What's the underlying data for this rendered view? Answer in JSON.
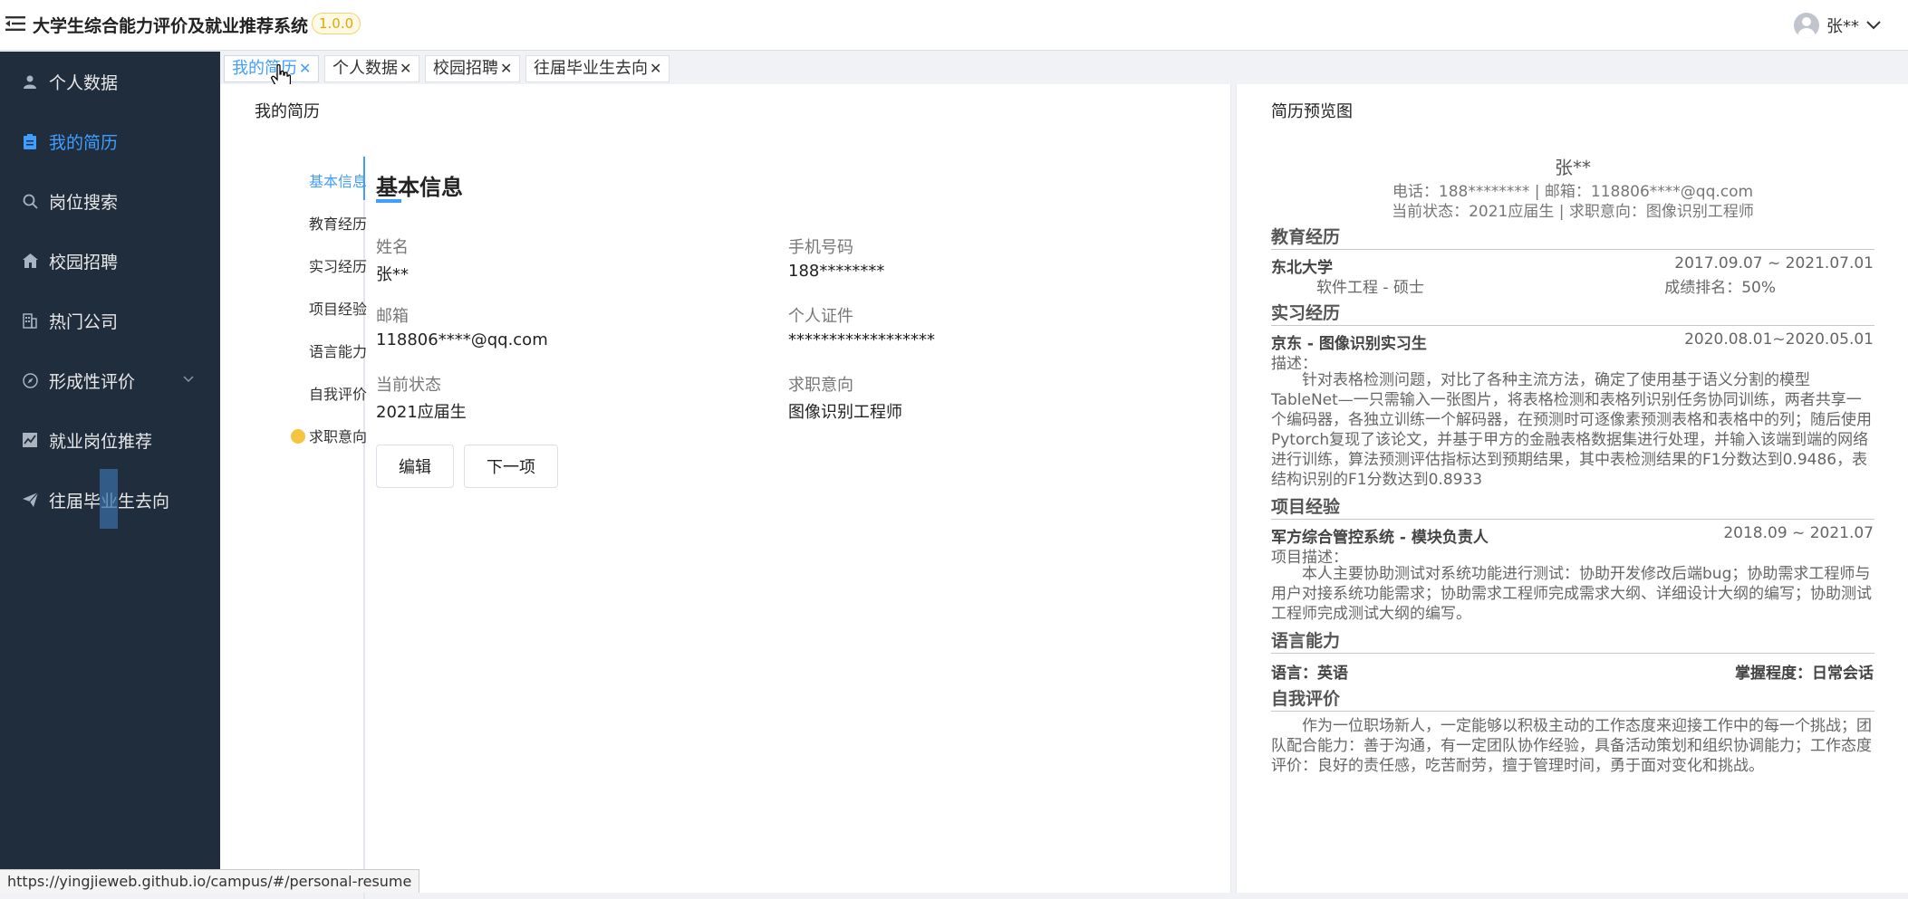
{
  "header": {
    "title": "大学生综合能力评价及就业推荐系统",
    "version": "1.0.0",
    "user_name": "张**"
  },
  "sidebar": {
    "items": [
      {
        "label": "个人数据",
        "icon": "user-icon"
      },
      {
        "label": "我的简历",
        "icon": "clipboard-icon"
      },
      {
        "label": "岗位搜索",
        "icon": "search-icon"
      },
      {
        "label": "校园招聘",
        "icon": "home-icon"
      },
      {
        "label": "热门公司",
        "icon": "building-icon"
      },
      {
        "label": "形成性评价",
        "icon": "compass-icon"
      },
      {
        "label": "就业岗位推荐",
        "icon": "chart-icon"
      },
      {
        "label": "往届毕业生去向",
        "icon": "send-icon"
      }
    ]
  },
  "tabs": [
    {
      "label": "我的简历"
    },
    {
      "label": "个人数据"
    },
    {
      "label": "校园招聘"
    },
    {
      "label": "往届毕业生去向"
    }
  ],
  "resume": {
    "panel_title": "我的简历",
    "steps": [
      "基本信息",
      "教育经历",
      "实习经历",
      "项目经验",
      "语言能力",
      "自我评价",
      "求职意向"
    ],
    "section_title": "基本信息",
    "fields": {
      "name_label": "姓名",
      "name_value": "张**",
      "phone_label": "手机号码",
      "phone_value": "188********",
      "email_label": "邮箱",
      "email_value": "118806****@qq.com",
      "id_label": "个人证件",
      "id_value": "******************",
      "status_label": "当前状态",
      "status_value": "2021应届生",
      "intent_label": "求职意向",
      "intent_value": "图像识别工程师"
    },
    "edit_button": "编辑",
    "next_button": "下一项"
  },
  "preview": {
    "panel_title": "简历预览图",
    "name": "张**",
    "contact_line": "电话：188******** | 邮箱：118806****@qq.com",
    "status_line": "当前状态：2021应届生 | 求职意向：图像识别工程师",
    "education": {
      "title": "教育经历",
      "school": "东北大学",
      "dates": "2017.09.07 ~ 2021.07.01",
      "major": "软件工程 - 硕士",
      "rank": "成绩排名：50%"
    },
    "internship": {
      "title": "实习经历",
      "role": "京东 - 图像识别实习生",
      "dates": "2020.08.01~2020.05.01",
      "desc_label": "描述：",
      "desc": "针对表格检测问题，对比了各种主流方法，确定了使用基于语义分割的模型TableNet—一只需输入一张图片，将表格检测和表格列识别任务协同训练，两者共享一个编码器，各独立训练一个解码器，在预测时可逐像素预测表格和表格中的列；随后使用Pytorch复现了该论文，并基于甲方的金融表格数据集进行处理，并输入该端到端的网络进行训练，算法预测评估指标达到预期结果，其中表检测结果的F1分数达到0.9486，表结构识别的F1分数达到0.8933"
    },
    "project": {
      "title": "项目经验",
      "role": "军方综合管控系统 - 模块负责人",
      "dates": "2018.09 ~ 2021.07",
      "desc_label": "项目描述：",
      "desc": "本人主要协助测试对系统功能进行测试：协助开发修改后端bug；协助需求工程师与用户对接系统功能需求；协助需求工程师完成需求大纲、详细设计大纲的编写；协助测试工程师完成测试大纲的编写。"
    },
    "language": {
      "title": "语言能力",
      "lang": "语言：英语",
      "level": "掌握程度：日常会话"
    },
    "self_eval": {
      "title": "自我评价",
      "text": "作为一位职场新人，一定能够以积极主动的工作态度来迎接工作中的每一个挑战；团队配合能力：善于沟通，有一定团队协作经验，具备活动策划和组织协调能力；工作态度评价：良好的责任感，吃苦耐劳，擅于管理时间，勇于面对变化和挑战。"
    }
  },
  "status_bar": {
    "url": "https://yingjieweb.github.io/campus/#/personal-resume"
  }
}
